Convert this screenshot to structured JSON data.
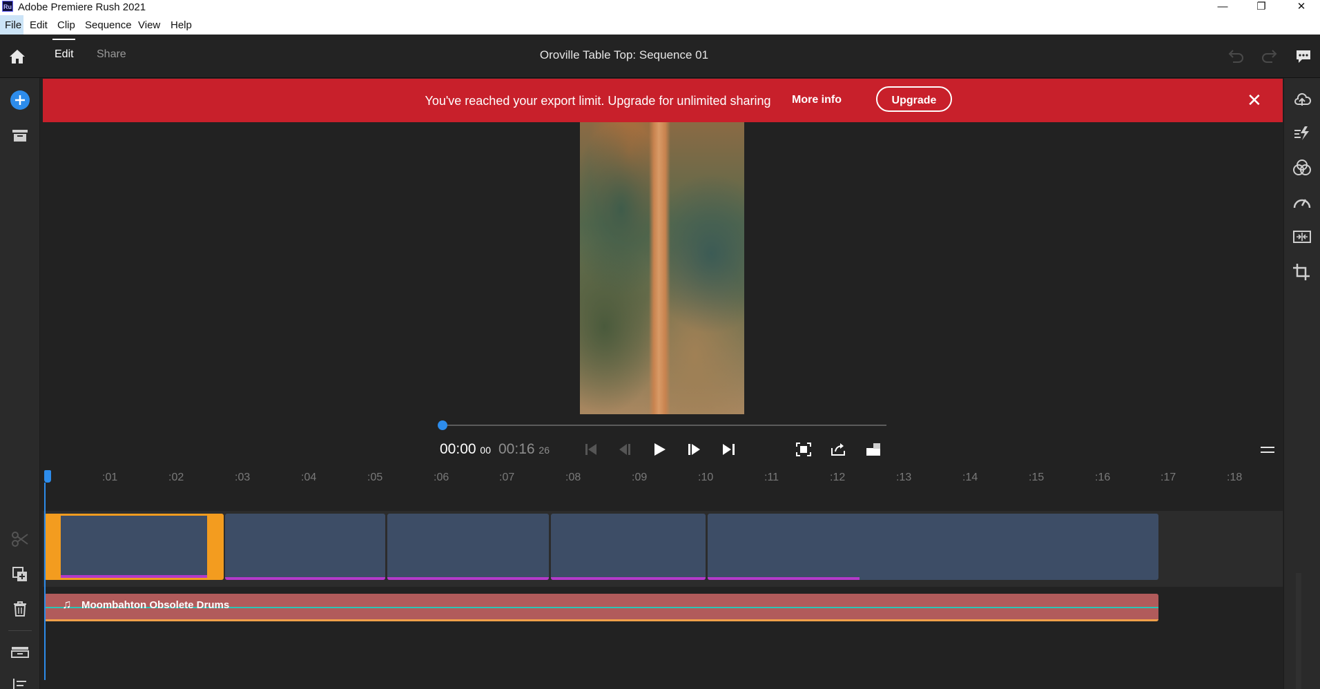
{
  "window": {
    "title": "Adobe Premiere Rush 2021",
    "app_icon_text": "Ru",
    "minimize": "—",
    "restore": "❐",
    "close": "✕"
  },
  "menu": [
    "File",
    "Edit",
    "Clip",
    "Sequence",
    "View",
    "Help"
  ],
  "header": {
    "tabs": [
      "Edit",
      "Share"
    ],
    "active_tab": "Edit",
    "sequence_title": "Oroville Table Top: Sequence 01"
  },
  "banner": {
    "message": "You've reached your export limit. Upgrade for unlimited sharing",
    "more_info": "More info",
    "upgrade": "Upgrade",
    "close": "✕"
  },
  "player": {
    "current_time": "00:00",
    "current_frames": "00",
    "duration": "00:16",
    "duration_frames": "26",
    "progress": 0
  },
  "ruler": {
    "ticks": [
      ":01",
      ":02",
      ":03",
      ":04",
      ":05",
      ":06",
      ":07",
      ":08",
      ":09",
      ":10",
      ":11",
      ":12",
      ":13",
      ":14",
      ":15",
      ":16",
      ":17",
      ":18"
    ]
  },
  "timeline": {
    "audio_track_name": "Moombahton Obsolete Drums"
  },
  "colors": {
    "accent_blue": "#2d8ceb",
    "banner_red": "#c8202b",
    "clip_blue": "#3d4d66",
    "selection_orange": "#f39c1f",
    "audio_red": "#b15b5b"
  }
}
